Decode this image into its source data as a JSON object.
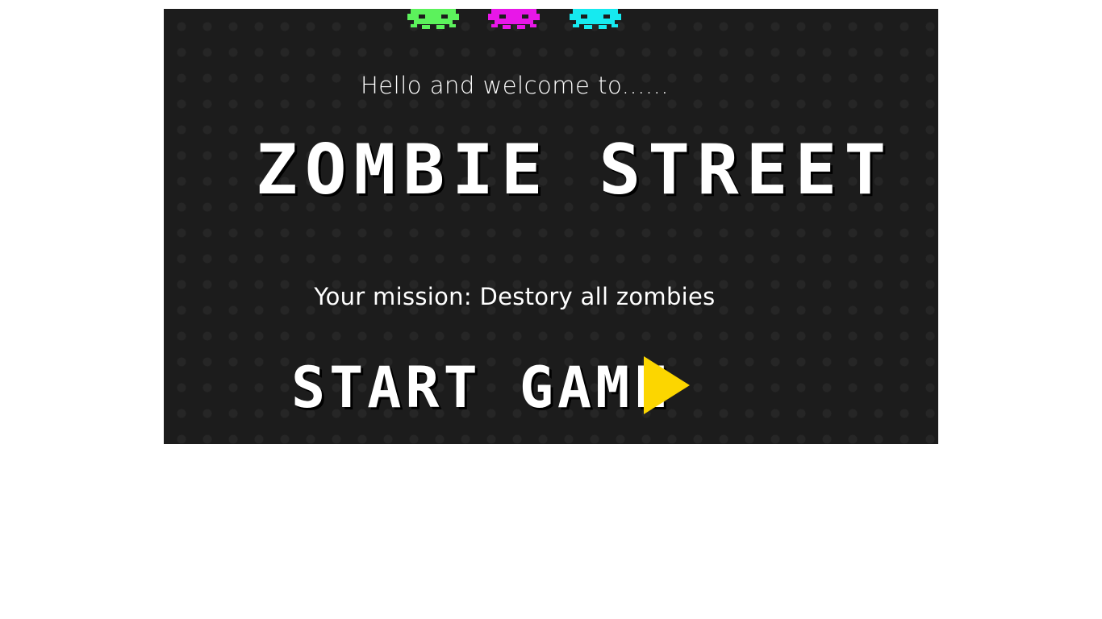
{
  "screen": {
    "welcome_text": "Hello and welcome to......",
    "title": "ZOMBIE STREET",
    "mission_text": "Your mission: Destory all zombies",
    "start_button_label": "START GAME"
  },
  "invaders": [
    {
      "name": "green",
      "color": "#5cf25c"
    },
    {
      "name": "magenta",
      "color": "#e817e8"
    },
    {
      "name": "cyan",
      "color": "#16eaf0"
    }
  ],
  "colors": {
    "background": "#1c1c1c",
    "text": "#ffffff",
    "play_icon": "#fcd600"
  },
  "icons": {
    "play": "play-triangle-icon",
    "invader": "space-invader-icon"
  }
}
